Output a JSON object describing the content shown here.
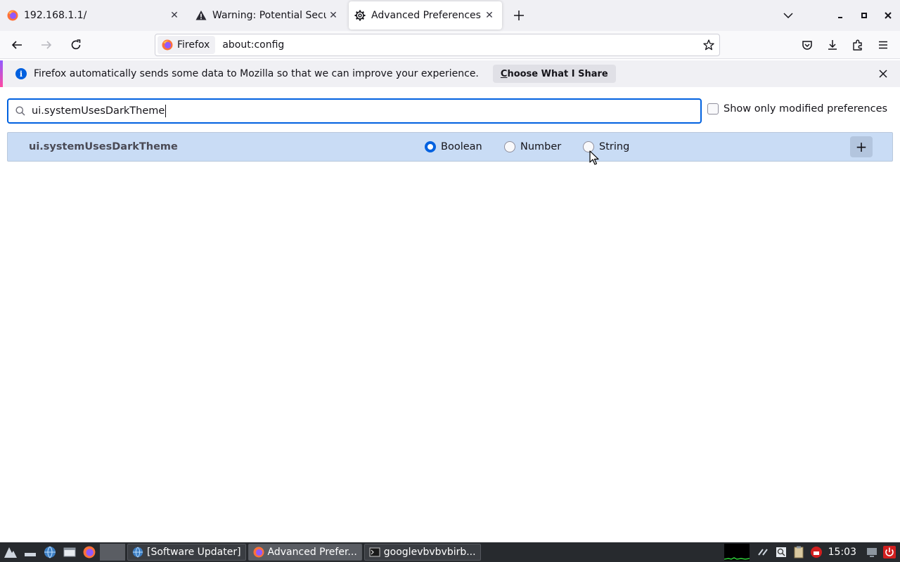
{
  "browser": {
    "tabs": [
      {
        "title": "192.168.1.1/",
        "icon": "firefox-icon"
      },
      {
        "title": "Warning: Potential Securi",
        "icon": "warning-icon"
      },
      {
        "title": "Advanced Preferences",
        "icon": "gear-icon",
        "active": true
      }
    ],
    "identity_label": "Firefox",
    "url": "about:config"
  },
  "notification": {
    "message": "Firefox automatically sends some data to Mozilla so that we can improve your experience.",
    "button_prefix": "C",
    "button_rest": "hoose What I Share"
  },
  "config": {
    "search_value": "ui.systemUsesDarkTheme",
    "modified_only_label": "Show only modified preferences",
    "modified_only_checked": false,
    "pref_name": "ui.systemUsesDarkTheme",
    "types": [
      {
        "label": "Boolean",
        "selected": true
      },
      {
        "label": "Number",
        "selected": false
      },
      {
        "label": "String",
        "selected": false
      }
    ],
    "add_label": "+"
  },
  "taskbar": {
    "tasks": [
      {
        "label": "[Software Updater]",
        "icon": "globe-icon"
      },
      {
        "label": "Advanced Prefer...",
        "icon": "firefox-icon",
        "active": true
      },
      {
        "label": "googlevbvbvbirb...",
        "icon": "terminal-icon"
      }
    ],
    "clock": "15:03"
  },
  "colors": {
    "accent": "#0061e0",
    "selected_row": "#c9dcf5"
  }
}
